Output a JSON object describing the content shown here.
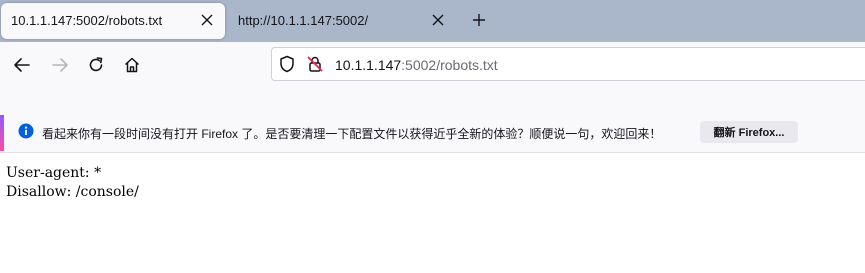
{
  "tabs": [
    {
      "title": "10.1.1.147:5002/robots.txt",
      "close_icon": "close-icon",
      "active": true
    },
    {
      "title": "http://10.1.1.147:5002/",
      "close_icon": "close-icon",
      "active": false
    }
  ],
  "new_tab_icon": "plus-icon",
  "nav": {
    "back_icon": "arrow-left-icon",
    "forward_icon": "arrow-right-icon",
    "reload_icon": "reload-icon",
    "home_icon": "home-icon"
  },
  "urlbar": {
    "host": "10.1.1.147",
    "rest": ":5002/robots.txt",
    "shield_icon": "shield-icon",
    "insecure_icon": "insecure-lock-icon"
  },
  "notification": {
    "icon": "info-icon",
    "message": "看起来你有一段时间没有打开 Firefox 了。是否要清理一下配置文件以获得近乎全新的体验？顺便说一句，欢迎回来！",
    "button_label": "翻新 Firefox...",
    "accent_colors": [
      "#9059ff",
      "#ff4aa2"
    ]
  },
  "content": {
    "lines": [
      "User-agent: *",
      "Disallow: /console/"
    ]
  },
  "colors": {
    "tabstrip_bg": "#aab6ca",
    "toolbar_bg": "#f9f9fb",
    "info_blue": "#0060df"
  }
}
